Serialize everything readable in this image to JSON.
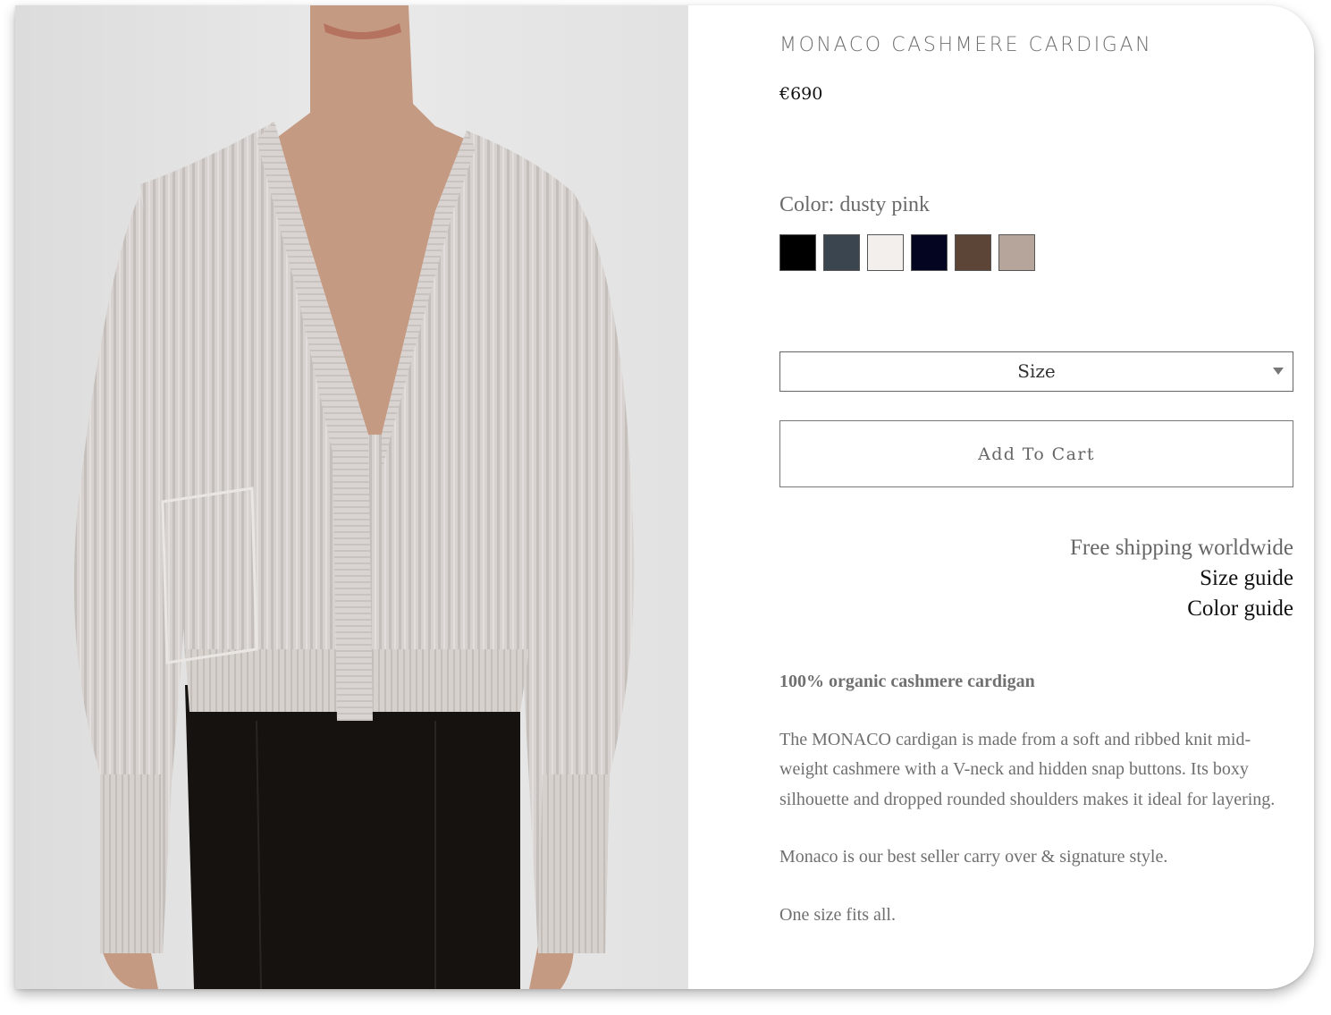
{
  "product": {
    "title": "MONACO CASHMERE CARDIGAN",
    "price": "€690",
    "image_alt": "Model wearing a light grey ribbed V-neck cashmere cardigan with dark velvet trousers"
  },
  "color": {
    "label": "Color: dusty pink",
    "swatches": [
      {
        "name": "black",
        "hex": "#000000"
      },
      {
        "name": "charcoal",
        "hex": "#3a4550"
      },
      {
        "name": "off-white",
        "hex": "#f3efec"
      },
      {
        "name": "navy",
        "hex": "#040520"
      },
      {
        "name": "brown",
        "hex": "#5c4537"
      },
      {
        "name": "dusty pink",
        "hex": "#b6a59b"
      }
    ]
  },
  "size_select": {
    "label": "Size"
  },
  "cart": {
    "button_label": "Add To Cart"
  },
  "links": {
    "shipping": "Free shipping worldwide",
    "size_guide": "Size guide",
    "color_guide": "Color guide"
  },
  "description": {
    "heading": "100% organic cashmere cardigan",
    "paragraph1": "The MONACO cardigan is made from a soft and ribbed knit mid-weight cashmere with a V-neck and hidden snap buttons. Its boxy silhouette and dropped rounded shoulders makes it ideal for layering.",
    "paragraph2": "Monaco is our best seller carry over & signature style.",
    "paragraph3": "One size fits all."
  }
}
